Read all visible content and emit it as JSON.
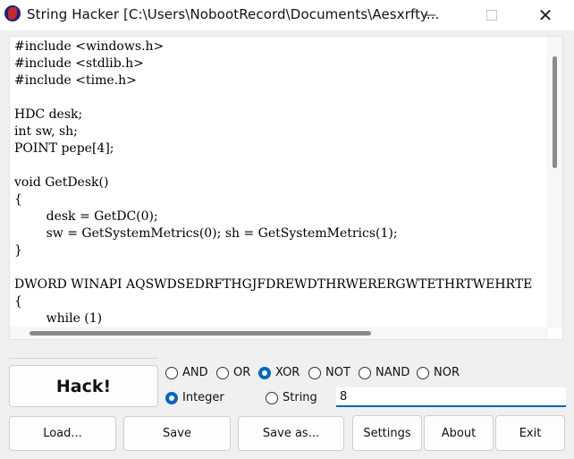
{
  "window": {
    "title": "String Hacker [C:\\Users\\NobootRecord\\Documents\\Aesxrfty...",
    "minimize_icon": "minimize-icon",
    "maximize_icon": "maximize-icon",
    "close_icon": "close-icon"
  },
  "editor": {
    "content": "#include <windows.h>\n#include <stdlib.h>\n#include <time.h>\n\nHDC desk;\nint sw, sh;\nPOINT pepe[4];\n\nvoid GetDesk()\n{\n\t\tdesk = GetDC(0);\n\t\tsw = GetSystemMetrics(0); sh = GetSystemMetrics(1);\n}\n\nDWORD WINAPI AQSWDSEDRFTHGJFDREWDTHRWERERGWTETHRTWEHRTE\n{\n\t\twhile (1)\n\t\t{"
  },
  "operations": [
    {
      "label": "AND",
      "selected": false
    },
    {
      "label": "OR",
      "selected": false
    },
    {
      "label": "XOR",
      "selected": true
    },
    {
      "label": "NOT",
      "selected": false
    },
    {
      "label": "NAND",
      "selected": false
    },
    {
      "label": "NOR",
      "selected": false
    }
  ],
  "key_types": [
    {
      "label": "Integer",
      "selected": true
    },
    {
      "label": "String",
      "selected": false
    }
  ],
  "key_value": "8",
  "buttons": {
    "hack": "Hack!",
    "load": "Load...",
    "save": "Save",
    "save_as": "Save as...",
    "settings": "Settings",
    "about": "About",
    "exit": "Exit"
  },
  "colors": {
    "accent": "#0067c0",
    "window_bg": "#f0f0f0"
  }
}
